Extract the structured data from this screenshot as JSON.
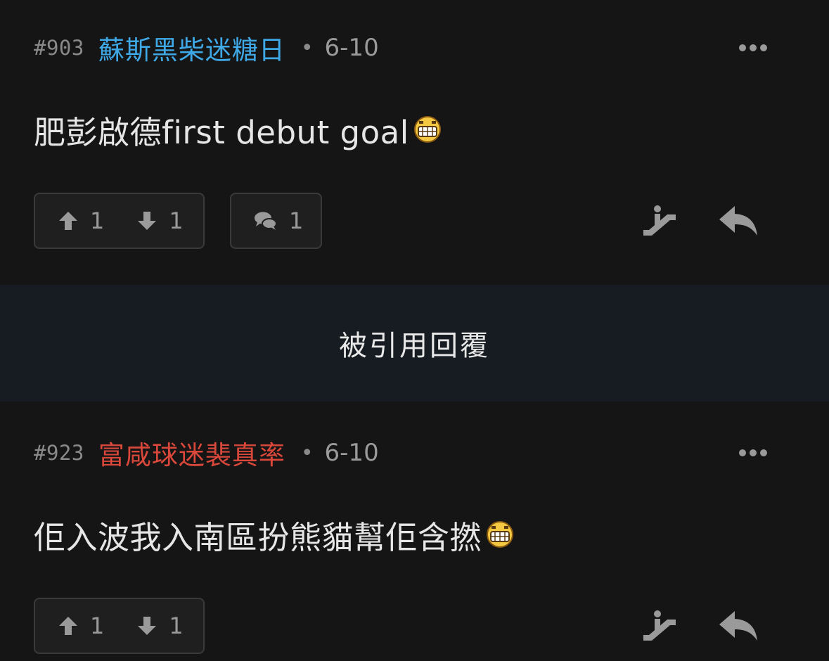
{
  "posts": [
    {
      "number": "#903",
      "author": "蘇斯黑柴迷糖日",
      "author_color": "#3fa9e8",
      "separator": "•",
      "date": "6-10",
      "content": "肥彭啟德first debut goal",
      "emoji_icon": "grin-emoji-icon",
      "upvotes": "1",
      "downvotes": "1",
      "comments": "1"
    },
    {
      "number": "#923",
      "author": "富咸球迷裴真率",
      "author_color": "#d9483b",
      "separator": "•",
      "date": "6-10",
      "content": "佢入波我入南區扮熊貓幫佢含撚",
      "emoji_icon": "grin-emoji-icon",
      "upvotes": "1",
      "downvotes": "1"
    }
  ],
  "quoted_banner": {
    "label": "被引用回覆"
  },
  "colors": {
    "background": "#151515",
    "banner_background": "#161c21",
    "muted_text": "#9a9a9a"
  }
}
